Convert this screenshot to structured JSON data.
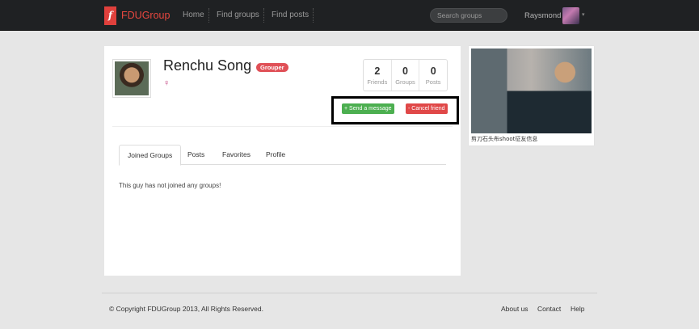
{
  "navbar": {
    "logo_glyph": "f",
    "brand": "FDUGroup",
    "links": [
      "Home",
      "Find groups",
      "Find posts"
    ],
    "search_placeholder": "Search groups",
    "username": "Raysmond",
    "caret": "▾"
  },
  "profile": {
    "name": "Renchu Song",
    "badge": "Grouper",
    "gender_glyph": "♀",
    "stats": [
      {
        "count": "2",
        "label": "Friends"
      },
      {
        "count": "0",
        "label": "Groups"
      },
      {
        "count": "0",
        "label": "Posts"
      }
    ],
    "buttons": {
      "send": "+ Send a message",
      "cancel": "- Cancel friend"
    },
    "tabs": [
      "Joined Groups",
      "Posts",
      "Favorites",
      "Profile"
    ],
    "active_tab": "Joined Groups",
    "empty_message": "This guy has not joined any groups!"
  },
  "sidebar": {
    "photo_caption": "剪刀石头布shoot征友信息"
  },
  "footer": {
    "copyright": "© Copyright FDUGroup 2013, All Rights Reserved.",
    "links": [
      "About us",
      "Contact",
      "Help"
    ]
  },
  "colors": {
    "navbar_bg": "#1f2123",
    "brand": "#e8473f",
    "badge": "#e05057",
    "send_button": "#4caf50",
    "cancel_button": "#e04848"
  }
}
